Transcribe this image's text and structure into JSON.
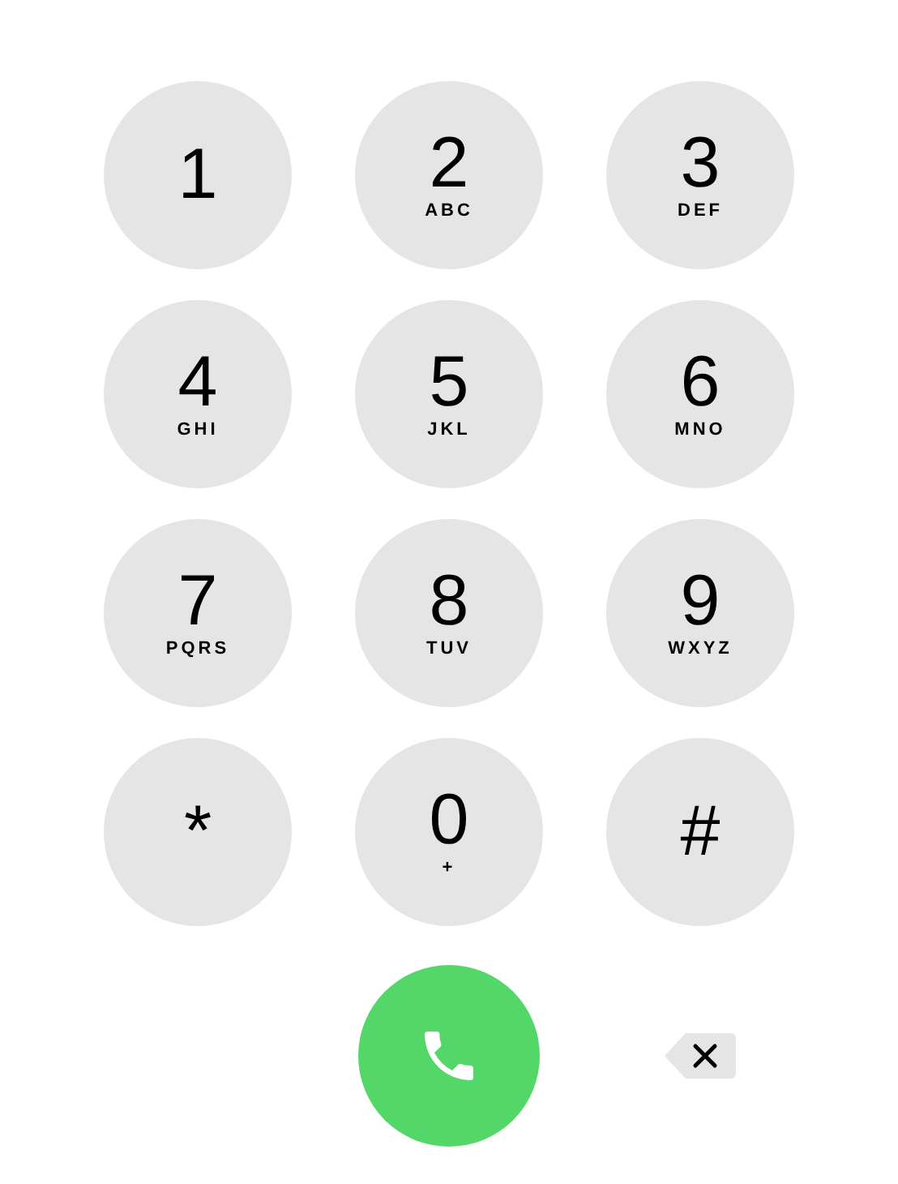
{
  "keys": [
    {
      "digit": "1"
    },
    {
      "digit": "2",
      "letters": "ABC"
    },
    {
      "digit": "3",
      "letters": "DEF"
    },
    {
      "digit": "4",
      "letters": "GHI"
    },
    {
      "digit": "5",
      "letters": "JKL"
    },
    {
      "digit": "6",
      "letters": "MNO"
    },
    {
      "digit": "7",
      "letters": "PQRS"
    },
    {
      "digit": "8",
      "letters": "TUV"
    },
    {
      "digit": "9",
      "letters": "WXYZ"
    },
    {
      "digit": "*"
    },
    {
      "digit": "0",
      "letters": "+"
    },
    {
      "digit": "#"
    }
  ]
}
